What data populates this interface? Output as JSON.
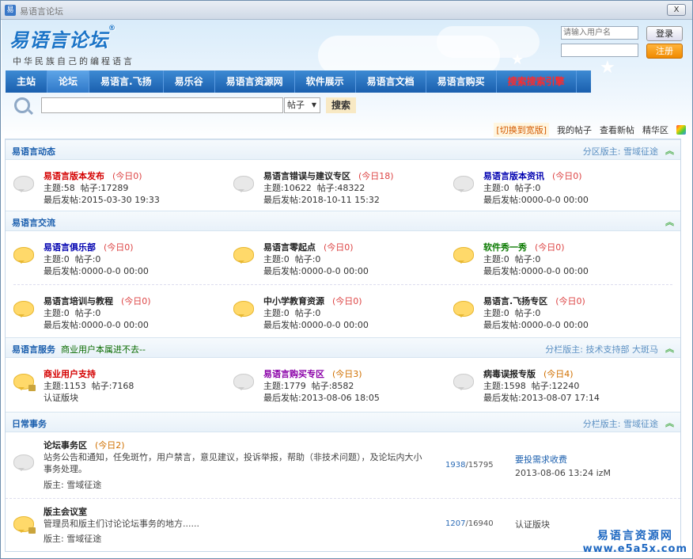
{
  "window": {
    "title": "易语言论坛",
    "close_label": "X"
  },
  "header": {
    "logo": "易语言论坛",
    "logo_mark": "®",
    "slogan": "中华民族自己的编程语言",
    "username_placeholder": "请输入用户名",
    "login_label": "登录",
    "register_label": "注册"
  },
  "nav": {
    "items": [
      "主站",
      "论坛",
      "易语言.飞扬",
      "易乐谷",
      "易语言资源网",
      "软件展示",
      "易语言文档",
      "易语言购买",
      "搜索搜索引擎"
    ]
  },
  "search": {
    "scope": "帖子",
    "button": "搜索"
  },
  "toolbar": {
    "switch": "[切换到宽版]",
    "my_posts": "我的帖子",
    "new_posts": "查看新帖",
    "digest": "精华区"
  },
  "sections": [
    {
      "title": "易语言动态",
      "moderators": "分区版主: 雪域征途",
      "forums": [
        {
          "name": "易语言版本发布",
          "color": "#d40000",
          "today": "(今日0)",
          "topics": "主题:58",
          "posts": "帖子:17289",
          "last": "最后发帖:2015-03-30 19:33"
        },
        {
          "name": "易语言错误与建议专区",
          "color": "#222222",
          "today": "(今日18)",
          "topics": "主题:10622",
          "posts": "帖子:48322",
          "last": "最后发帖:2018-10-11 15:32"
        },
        {
          "name": "易语言版本资讯",
          "color": "#0000b0",
          "today": "(今日0)",
          "topics": "主题:0",
          "posts": "帖子:0",
          "last": "最后发帖:0000-0-0 00:00"
        }
      ]
    },
    {
      "title": "易语言交流",
      "moderators": "",
      "forums": [
        {
          "name": "易语言俱乐部",
          "color": "#0000b0",
          "today": "(今日0)",
          "topics": "主题:0",
          "posts": "帖子:0",
          "last": "最后发帖:0000-0-0 00:00"
        },
        {
          "name": "易语言零起点",
          "color": "#222222",
          "today": "(今日0)",
          "topics": "主题:0",
          "posts": "帖子:0",
          "last": "最后发帖:0000-0-0 00:00"
        },
        {
          "name": "软件秀一秀",
          "color": "#0a7a00",
          "today": "(今日0)",
          "topics": "主题:0",
          "posts": "帖子:0",
          "last": "最后发帖:0000-0-0 00:00"
        },
        {
          "name": "易语言培训与教程",
          "color": "#222222",
          "today": "(今日0)",
          "topics": "主题:0",
          "posts": "帖子:0",
          "last": "最后发帖:0000-0-0 00:00"
        },
        {
          "name": "中小学教育资源",
          "color": "#222222",
          "today": "(今日0)",
          "topics": "主题:0",
          "posts": "帖子:0",
          "last": "最后发帖:0000-0-0 00:00"
        },
        {
          "name": "易语言.飞扬专区",
          "color": "#222222",
          "today": "(今日0)",
          "topics": "主题:0",
          "posts": "帖子:0",
          "last": "最后发帖:0000-0-0 00:00"
        }
      ]
    },
    {
      "title": "易语言服务",
      "extra": "商业用户本属进不去--",
      "moderators": "分栏版主: 技术支持部 大斑马",
      "forums": [
        {
          "name": "商业用户支持",
          "color": "#d40000",
          "today": "(今日0)",
          "topics": "主题:1153",
          "posts": "帖子:7168",
          "last": "认证版块"
        },
        {
          "name": "易语言购买专区",
          "color": "#8a00a8",
          "today": "(今日3)",
          "topics": "主题:1779",
          "posts": "帖子:8582",
          "last": "最后发帖:2013-08-06 18:05"
        },
        {
          "name": "病毒误报专版",
          "color": "#222222",
          "today": "(今日4)",
          "topics": "主题:1598",
          "posts": "帖子:12240",
          "last": "最后发帖:2013-08-07 17:14"
        }
      ]
    },
    {
      "title": "日常事务",
      "moderators": "分栏版主: 雪域征途",
      "rows": [
        {
          "name": "论坛事务区",
          "today": "(今日2)",
          "desc": "站务公告和通知，任免斑竹，用户禁言，意见建议，投诉举报，帮助（非技术问题），及论坛内大小事务处理。",
          "mods": "版主: 雪域征途",
          "count_a": "1938",
          "count_b": "/15795",
          "last_link": "要投需求收费",
          "last_time": "2013-08-06 13:24 izM"
        },
        {
          "name": "版主会议室",
          "today": "",
          "desc": "管理员和版主们讨论论坛事务的地方......",
          "mods": "版主: 雪域征途",
          "count_a": "1207",
          "count_b": "/16940",
          "last_link": "认证版块",
          "last_time": ""
        }
      ]
    }
  ],
  "watermark": {
    "line1": "易语言资源网",
    "line2": "www.e5a5x.com"
  }
}
